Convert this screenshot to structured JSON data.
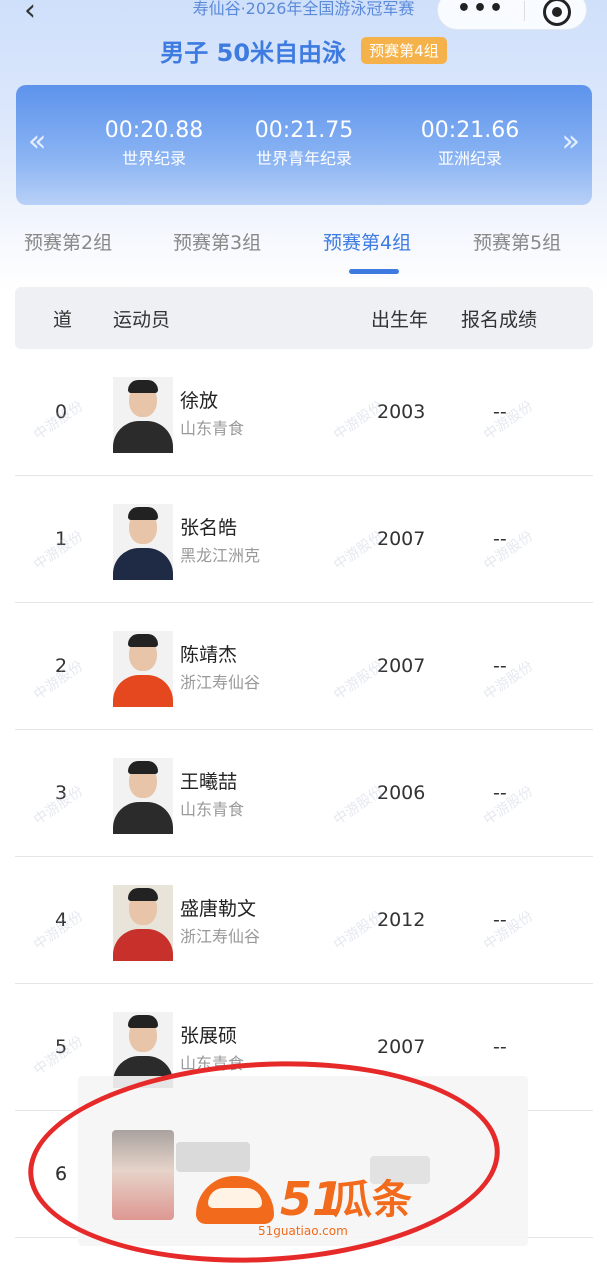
{
  "header": {
    "back_icon": "chevron-left-icon",
    "meet_title": "寿仙谷·2026年全国游泳冠军赛",
    "more_icon": "more-dots-icon",
    "close_icon": "target-circle-icon",
    "event_title": "男子 50米自由泳",
    "event_badge": "预赛第4组"
  },
  "records": [
    {
      "time": "00:20.88",
      "label": "世界纪录"
    },
    {
      "time": "00:21.75",
      "label": "世界青年纪录"
    },
    {
      "time": "00:21.66",
      "label": "亚洲纪录"
    }
  ],
  "tabs": [
    {
      "label": "预赛第2组",
      "active": false
    },
    {
      "label": "预赛第3组",
      "active": false
    },
    {
      "label": "预赛第4组",
      "active": true
    },
    {
      "label": "预赛第5组",
      "active": false
    }
  ],
  "table": {
    "headers": {
      "lane": "道",
      "athlete": "运动员",
      "birth_year": "出生年",
      "entry_time": "报名成绩"
    },
    "rows": [
      {
        "lane": "0",
        "name": "徐放",
        "team": "山东青食",
        "year": "2003",
        "entry": "--"
      },
      {
        "lane": "1",
        "name": "张名皓",
        "team": "黑龙江洲克",
        "year": "2007",
        "entry": "--"
      },
      {
        "lane": "2",
        "name": "陈靖杰",
        "team": "浙江寿仙谷",
        "year": "2007",
        "entry": "--"
      },
      {
        "lane": "3",
        "name": "王曦喆",
        "team": "山东青食",
        "year": "2006",
        "entry": "--"
      },
      {
        "lane": "4",
        "name": "盛唐勒文",
        "team": "浙江寿仙谷",
        "year": "2012",
        "entry": "--"
      },
      {
        "lane": "5",
        "name": "张展硕",
        "team": "山东青食",
        "year": "2007",
        "entry": "--"
      },
      {
        "lane": "6",
        "name": "",
        "team": "",
        "year": "",
        "entry": ""
      }
    ]
  },
  "watermark": {
    "brand": "51瓜条",
    "url": "51guatiao.com"
  },
  "colors": {
    "accent": "#3d7be0",
    "badge": "#f6b24a",
    "record_panel": "#5d93ec",
    "annotation": "#e62a2a",
    "logo": "#f26a1b"
  }
}
